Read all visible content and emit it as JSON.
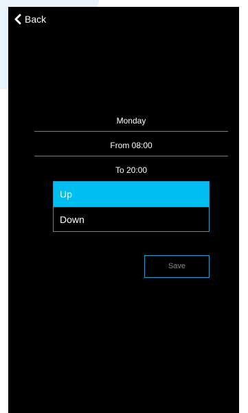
{
  "header": {
    "back_icon": "chevron-left-icon",
    "back_label": "Back"
  },
  "schedule": {
    "day": "Monday",
    "from": "From 08:00",
    "to": "To 20:00"
  },
  "direction": {
    "options": [
      "Up",
      "Down"
    ],
    "selected": "Up"
  },
  "actions": {
    "save_label": "Save"
  },
  "colors": {
    "screen_background": "#000000",
    "accent": "#1a9fd0",
    "selected_item": "#00bff0",
    "text": "#ffffff",
    "disabled_text": "#8a8a8a",
    "outer_background": "#ffffff",
    "decoration": "#e9f3fb"
  }
}
